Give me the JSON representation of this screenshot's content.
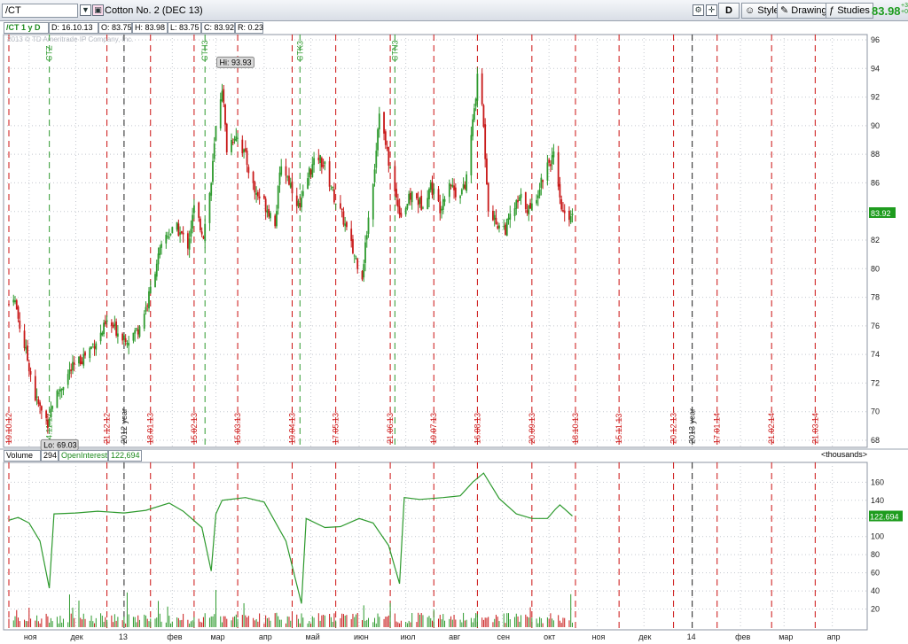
{
  "toolbar": {
    "symbol_value": "/CT",
    "instrument_name": "Cotton No. 2 (DEC 13)",
    "d_label": "D",
    "style_label": "Style",
    "drawings_label": "Drawings",
    "studies_label": "Studies",
    "last_price": "83.98",
    "change_small": "+3\n+0"
  },
  "info_bar": {
    "chart_label": "/CT 1 y D",
    "date": "D: 16.10.13",
    "open": "O: 83.75",
    "high": "H: 83.98",
    "low": "L: 83.75",
    "close": "C: 83.92",
    "range": "R: 0.23"
  },
  "copyright": "2013 © TD Ameritrade IP Company, Inc.",
  "volume_header": {
    "volume_label": "Volume",
    "volume_value": "294",
    "oi_label": "OpenInterest",
    "oi_value": "122,694",
    "units": "<thousands>"
  },
  "price_marker": "83.92",
  "oi_marker": "122.694",
  "hi_label": "Hi: 93.93",
  "lo_label": "Lo: 69.03",
  "colors": {
    "up": "#2e9a2e",
    "down": "#c81818",
    "event": "#cc1111",
    "oi": "#2e9a2e",
    "grid": "#c4c8cf"
  },
  "chart_data": [
    {
      "type": "candlestick",
      "price_axis": {
        "range": [
          68,
          96
        ],
        "ticks": [
          68,
          70,
          72,
          74,
          76,
          78,
          80,
          82,
          84,
          86,
          88,
          90,
          92,
          94,
          96
        ]
      },
      "x_range": [
        "2012-10-19",
        "2014-04-20"
      ],
      "annotations": [
        {
          "label": "Hi: 93.93",
          "date": "2013-03-05",
          "value": 93.93
        },
        {
          "label": "Lo: 69.03",
          "date": "2012-11-12",
          "value": 69.03
        }
      ],
      "last_value": 83.92,
      "closes": [
        {
          "date": "2012-10-19",
          "close": 77.5
        },
        {
          "date": "2012-10-22",
          "close": 78.2
        },
        {
          "date": "2012-10-26",
          "close": 76.0
        },
        {
          "date": "2012-11-01",
          "close": 73.2
        },
        {
          "date": "2012-11-05",
          "close": 71.0
        },
        {
          "date": "2012-11-09",
          "close": 70.0
        },
        {
          "date": "2012-11-13",
          "close": 69.3
        },
        {
          "date": "2012-11-16",
          "close": 70.6
        },
        {
          "date": "2012-11-21",
          "close": 71.6
        },
        {
          "date": "2012-11-27",
          "close": 72.8
        },
        {
          "date": "2012-12-03",
          "close": 73.5
        },
        {
          "date": "2012-12-10",
          "close": 74.4
        },
        {
          "date": "2012-12-17",
          "close": 75.4
        },
        {
          "date": "2012-12-21",
          "close": 76.2
        },
        {
          "date": "2012-12-28",
          "close": 75.6
        },
        {
          "date": "2013-01-04",
          "close": 75.1
        },
        {
          "date": "2013-01-10",
          "close": 75.8
        },
        {
          "date": "2013-01-16",
          "close": 77.6
        },
        {
          "date": "2013-01-22",
          "close": 80.5
        },
        {
          "date": "2013-01-28",
          "close": 82.3
        },
        {
          "date": "2013-02-04",
          "close": 82.8
        },
        {
          "date": "2013-02-11",
          "close": 81.7
        },
        {
          "date": "2013-02-15",
          "close": 84.2
        },
        {
          "date": "2013-02-21",
          "close": 82.4
        },
        {
          "date": "2013-02-26",
          "close": 86.0
        },
        {
          "date": "2013-03-01",
          "close": 89.8
        },
        {
          "date": "2013-03-05",
          "close": 92.8
        },
        {
          "date": "2013-03-08",
          "close": 88.4
        },
        {
          "date": "2013-03-14",
          "close": 89.5
        },
        {
          "date": "2013-03-20",
          "close": 87.8
        },
        {
          "date": "2013-03-26",
          "close": 85.4
        },
        {
          "date": "2013-04-01",
          "close": 84.6
        },
        {
          "date": "2013-04-08",
          "close": 83.3
        },
        {
          "date": "2013-04-12",
          "close": 87.4
        },
        {
          "date": "2013-04-18",
          "close": 85.9
        },
        {
          "date": "2013-04-24",
          "close": 84.2
        },
        {
          "date": "2013-04-30",
          "close": 86.8
        },
        {
          "date": "2013-05-06",
          "close": 87.8
        },
        {
          "date": "2013-05-10",
          "close": 87.1
        },
        {
          "date": "2013-05-16",
          "close": 85.0
        },
        {
          "date": "2013-05-22",
          "close": 83.4
        },
        {
          "date": "2013-05-28",
          "close": 81.2
        },
        {
          "date": "2013-06-03",
          "close": 79.6
        },
        {
          "date": "2013-06-06",
          "close": 82.6
        },
        {
          "date": "2013-06-11",
          "close": 87.2
        },
        {
          "date": "2013-06-14",
          "close": 91.2
        },
        {
          "date": "2013-06-18",
          "close": 88.6
        },
        {
          "date": "2013-06-24",
          "close": 85.3
        },
        {
          "date": "2013-06-28",
          "close": 83.8
        },
        {
          "date": "2013-07-05",
          "close": 85.2
        },
        {
          "date": "2013-07-11",
          "close": 84.5
        },
        {
          "date": "2013-07-17",
          "close": 85.8
        },
        {
          "date": "2013-07-23",
          "close": 84.3
        },
        {
          "date": "2013-07-29",
          "close": 86.2
        },
        {
          "date": "2013-08-02",
          "close": 85.3
        },
        {
          "date": "2013-08-08",
          "close": 85.6
        },
        {
          "date": "2013-08-13",
          "close": 90.2
        },
        {
          "date": "2013-08-16",
          "close": 93.2
        },
        {
          "date": "2013-08-19",
          "close": 91.6
        },
        {
          "date": "2013-08-23",
          "close": 84.4
        },
        {
          "date": "2013-08-28",
          "close": 83.2
        },
        {
          "date": "2013-09-03",
          "close": 82.8
        },
        {
          "date": "2013-09-09",
          "close": 84.3
        },
        {
          "date": "2013-09-13",
          "close": 84.9
        },
        {
          "date": "2013-09-19",
          "close": 84.0
        },
        {
          "date": "2013-09-25",
          "close": 85.8
        },
        {
          "date": "2013-09-30",
          "close": 87.4
        },
        {
          "date": "2013-10-04",
          "close": 87.8
        },
        {
          "date": "2013-10-08",
          "close": 84.6
        },
        {
          "date": "2013-10-11",
          "close": 83.5
        },
        {
          "date": "2013-10-16",
          "close": 83.92
        }
      ]
    },
    {
      "type": "line",
      "name": "OpenInterest",
      "y_axis": {
        "range": [
          0,
          175
        ],
        "ticks": [
          20,
          40,
          60,
          80,
          100,
          120,
          140,
          160
        ],
        "units": "thousands"
      },
      "last_value": 122.694,
      "series": [
        {
          "date": "2012-10-19",
          "value": 118
        },
        {
          "date": "2012-10-25",
          "value": 121
        },
        {
          "date": "2012-11-01",
          "value": 115
        },
        {
          "date": "2012-11-08",
          "value": 95
        },
        {
          "date": "2012-11-14",
          "value": 43
        },
        {
          "date": "2012-11-17",
          "value": 125
        },
        {
          "date": "2012-12-01",
          "value": 126
        },
        {
          "date": "2012-12-15",
          "value": 128
        },
        {
          "date": "2013-01-01",
          "value": 126
        },
        {
          "date": "2013-01-15",
          "value": 129
        },
        {
          "date": "2013-01-30",
          "value": 137
        },
        {
          "date": "2013-02-08",
          "value": 128
        },
        {
          "date": "2013-02-20",
          "value": 110
        },
        {
          "date": "2013-02-26",
          "value": 62
        },
        {
          "date": "2013-03-01",
          "value": 125
        },
        {
          "date": "2013-03-05",
          "value": 140
        },
        {
          "date": "2013-03-20",
          "value": 143
        },
        {
          "date": "2013-04-01",
          "value": 138
        },
        {
          "date": "2013-04-15",
          "value": 95
        },
        {
          "date": "2013-04-25",
          "value": 26
        },
        {
          "date": "2013-04-28",
          "value": 120
        },
        {
          "date": "2013-05-10",
          "value": 110
        },
        {
          "date": "2013-05-20",
          "value": 111
        },
        {
          "date": "2013-06-01",
          "value": 120
        },
        {
          "date": "2013-06-10",
          "value": 115
        },
        {
          "date": "2013-06-20",
          "value": 90
        },
        {
          "date": "2013-06-27",
          "value": 48
        },
        {
          "date": "2013-06-30",
          "value": 143
        },
        {
          "date": "2013-07-10",
          "value": 141
        },
        {
          "date": "2013-07-25",
          "value": 143
        },
        {
          "date": "2013-08-05",
          "value": 145
        },
        {
          "date": "2013-08-13",
          "value": 160
        },
        {
          "date": "2013-08-20",
          "value": 170
        },
        {
          "date": "2013-08-30",
          "value": 142
        },
        {
          "date": "2013-09-10",
          "value": 125
        },
        {
          "date": "2013-09-20",
          "value": 120
        },
        {
          "date": "2013-09-30",
          "value": 120
        },
        {
          "date": "2013-10-05",
          "value": 130
        },
        {
          "date": "2013-10-08",
          "value": 135
        },
        {
          "date": "2013-10-16",
          "value": 122.694
        }
      ]
    },
    {
      "type": "bar",
      "name": "Volume",
      "y_axis": {
        "range": [
          0,
          175
        ],
        "units": "thousands"
      },
      "last_value": 294
    }
  ],
  "event_markers": [
    {
      "date": "2012-10-19",
      "label": "19.10.12",
      "style": "red"
    },
    {
      "date": "2012-11-14",
      "label": "14.11.12",
      "style": "green",
      "symbol": "CTZ"
    },
    {
      "date": "2012-12-21",
      "label": "21.12.12",
      "style": "red"
    },
    {
      "date": "2013-01-01",
      "label": "2012 year",
      "style": "black"
    },
    {
      "date": "2013-01-18",
      "label": "18.01.13",
      "style": "red"
    },
    {
      "date": "2013-02-15",
      "label": "15.02.13",
      "style": "red"
    },
    {
      "date": "2013-02-22",
      "label": "",
      "style": "green",
      "symbol": "CTH3"
    },
    {
      "date": "2013-03-15",
      "label": "15.03.13",
      "style": "red"
    },
    {
      "date": "2013-04-19",
      "label": "19.04.13",
      "style": "red"
    },
    {
      "date": "2013-04-24",
      "label": "",
      "style": "green",
      "symbol": "CTK3"
    },
    {
      "date": "2013-05-17",
      "label": "17.05.13",
      "style": "red"
    },
    {
      "date": "2013-06-21",
      "label": "21.06.13",
      "style": "red"
    },
    {
      "date": "2013-06-24",
      "label": "",
      "style": "green",
      "symbol": "CTN3"
    },
    {
      "date": "2013-07-19",
      "label": "19.07.13",
      "style": "red"
    },
    {
      "date": "2013-08-16",
      "label": "16.08.13",
      "style": "red"
    },
    {
      "date": "2013-09-20",
      "label": "20.09.13",
      "style": "red"
    },
    {
      "date": "2013-10-18",
      "label": "18.10.13",
      "style": "red"
    },
    {
      "date": "2013-11-15",
      "label": "15.11.13",
      "style": "red"
    },
    {
      "date": "2013-12-20",
      "label": "20.12.13",
      "style": "red"
    },
    {
      "date": "2014-01-01",
      "label": "2013 year",
      "style": "black"
    },
    {
      "date": "2014-01-17",
      "label": "17.01.14",
      "style": "red"
    },
    {
      "date": "2014-02-21",
      "label": "21.02.14",
      "style": "red"
    },
    {
      "date": "2014-03-21",
      "label": "21.03.14",
      "style": "red"
    }
  ],
  "month_ticks": [
    {
      "date": "2012-11-01",
      "label": "ноя"
    },
    {
      "date": "2012-12-01",
      "label": "дек"
    },
    {
      "date": "2013-01-01",
      "label": "13"
    },
    {
      "date": "2013-02-01",
      "label": "фев"
    },
    {
      "date": "2013-03-01",
      "label": "мар"
    },
    {
      "date": "2013-04-01",
      "label": "апр"
    },
    {
      "date": "2013-05-01",
      "label": "май"
    },
    {
      "date": "2013-06-01",
      "label": "июн"
    },
    {
      "date": "2013-07-01",
      "label": "июл"
    },
    {
      "date": "2013-08-01",
      "label": "авг"
    },
    {
      "date": "2013-09-01",
      "label": "сен"
    },
    {
      "date": "2013-10-01",
      "label": "окт"
    },
    {
      "date": "2013-11-01",
      "label": "ноя"
    },
    {
      "date": "2013-12-01",
      "label": "дек"
    },
    {
      "date": "2014-01-01",
      "label": "14"
    },
    {
      "date": "2014-02-01",
      "label": "фев"
    },
    {
      "date": "2014-03-01",
      "label": "мар"
    },
    {
      "date": "2014-04-01",
      "label": "апр"
    }
  ]
}
